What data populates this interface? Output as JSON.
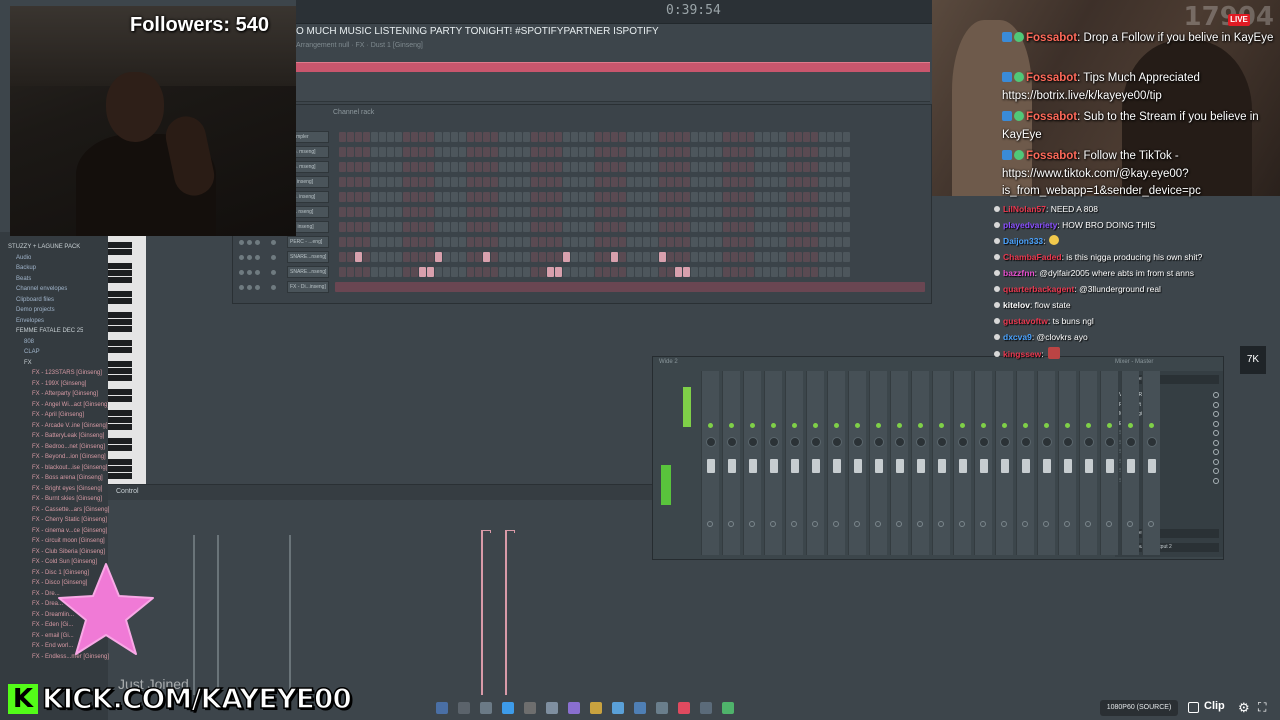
{
  "daw": {
    "time": "0:39:54",
    "marquee": "O MUCH MUSIC LISTENING PARTY TONIGHT! #SPOTIFYPARTNER ISPOTIFY",
    "pattern_label": "Arrangement null · FX · Dust 1 [Ginseng]",
    "channel_rack_title": "Channel rack",
    "channels": [
      {
        "name": "Sampler"
      },
      {
        "name": "Co. mseng]"
      },
      {
        "name": "Ch. mseng]"
      },
      {
        "name": "Fl. inseng]"
      },
      {
        "name": "Cu. inseng]"
      },
      {
        "name": "Lo. nseng]"
      },
      {
        "name": "Ci. inseng]"
      },
      {
        "name": "PERC - ...eng]"
      },
      {
        "name": "SNARE...nseng]"
      },
      {
        "name": "SNARE...nseng]"
      },
      {
        "name": "FX - Di...inseng]"
      }
    ],
    "browser": {
      "items": [
        {
          "label": "STUZZY + LAGUNE PACK",
          "indent": 0,
          "color": "#c8d0d4"
        },
        {
          "label": "Audio",
          "indent": 1,
          "color": "#9fb3c9"
        },
        {
          "label": "Backup",
          "indent": 1,
          "color": "#9fb3c9"
        },
        {
          "label": "Beats",
          "indent": 1,
          "color": "#9fb3c9"
        },
        {
          "label": "Channel envelopes",
          "indent": 1,
          "color": "#9fb3c9"
        },
        {
          "label": "Clipboard files",
          "indent": 1,
          "color": "#9fb3c9"
        },
        {
          "label": "Demo projects",
          "indent": 1,
          "color": "#9fb3c9"
        },
        {
          "label": "Envelopes",
          "indent": 1,
          "color": "#9fb3c9"
        },
        {
          "label": "FEMME FATALE DEC 25",
          "indent": 1,
          "color": "#c8d0d4"
        },
        {
          "label": "808",
          "indent": 2,
          "color": "#9fb3c9"
        },
        {
          "label": "CLAP",
          "indent": 2,
          "color": "#9fb3c9"
        },
        {
          "label": "FX",
          "indent": 2,
          "color": "#c8d0d4"
        },
        {
          "label": "FX - 123STARS [Ginseng]",
          "indent": 3,
          "color": "#d69aa4"
        },
        {
          "label": "FX - 199X [Ginseng]",
          "indent": 3,
          "color": "#d69aa4"
        },
        {
          "label": "FX - Afterparty [Ginseng]",
          "indent": 3,
          "color": "#d69aa4"
        },
        {
          "label": "FX - Angel Wi...act [Ginseng]",
          "indent": 3,
          "color": "#d69aa4"
        },
        {
          "label": "FX - April [Ginseng]",
          "indent": 3,
          "color": "#d69aa4"
        },
        {
          "label": "FX - Arcade V..ine [Ginseng]",
          "indent": 3,
          "color": "#d69aa4"
        },
        {
          "label": "FX - BatteryLeak [Ginseng]",
          "indent": 3,
          "color": "#d69aa4"
        },
        {
          "label": "FX - Bedroo...net [Ginseng]",
          "indent": 3,
          "color": "#d69aa4"
        },
        {
          "label": "FX - Beyond...ion [Ginseng]",
          "indent": 3,
          "color": "#d69aa4"
        },
        {
          "label": "FX - blackout...ise [Ginseng]",
          "indent": 3,
          "color": "#d69aa4"
        },
        {
          "label": "FX - Boss arena [Ginseng]",
          "indent": 3,
          "color": "#d69aa4"
        },
        {
          "label": "FX - Bright eyes [Ginseng]",
          "indent": 3,
          "color": "#d69aa4"
        },
        {
          "label": "FX - Burnt skies [Ginseng]",
          "indent": 3,
          "color": "#d69aa4"
        },
        {
          "label": "FX - Cassette...ars [Ginseng]",
          "indent": 3,
          "color": "#d69aa4"
        },
        {
          "label": "FX - Cherry Static [Ginseng]",
          "indent": 3,
          "color": "#d69aa4"
        },
        {
          "label": "FX - cinema v...ce [Ginseng]",
          "indent": 3,
          "color": "#d69aa4"
        },
        {
          "label": "FX - circuit moon [Ginseng]",
          "indent": 3,
          "color": "#d69aa4"
        },
        {
          "label": "FX - Club Siberia [Ginseng]",
          "indent": 3,
          "color": "#d69aa4"
        },
        {
          "label": "FX - Cold Sun [Ginseng]",
          "indent": 3,
          "color": "#d69aa4"
        },
        {
          "label": "FX - Disc 1 [Ginseng]",
          "indent": 3,
          "color": "#d69aa4"
        },
        {
          "label": "FX - Disco [Ginseng]",
          "indent": 3,
          "color": "#d69aa4"
        },
        {
          "label": "FX - Dre...",
          "indent": 3,
          "color": "#d69aa4"
        },
        {
          "label": "FX - Drea...",
          "indent": 3,
          "color": "#d69aa4"
        },
        {
          "label": "FX - Dreamlin...",
          "indent": 3,
          "color": "#d69aa4"
        },
        {
          "label": "FX - Eden [Gi...",
          "indent": 3,
          "color": "#d69aa4"
        },
        {
          "label": "FX - email [Gi...",
          "indent": 3,
          "color": "#d69aa4"
        },
        {
          "label": "FX - End worl...",
          "indent": 3,
          "color": "#d69aa4"
        },
        {
          "label": "FX - Endless...mer [Ginseng]",
          "indent": 3,
          "color": "#d69aa4"
        }
      ]
    },
    "control_label": "Control",
    "mixer": {
      "title": "Wide 2",
      "title_right": "Mixer - Master",
      "strip_count": 22,
      "slot_select_top": "(none)",
      "slots": [
        "VoxengoRecorder",
        "Fruity soft clipper",
        "MuseFlugin",
        "Edison",
        "Slot 5",
        "Slot 6",
        "Slot 7",
        "Slot 8",
        "Slot 9",
        "Slot 10"
      ],
      "slot_select_bottom": "(none)",
      "output": "Output 1 - Output 2"
    }
  },
  "stream": {
    "followers": "Followers: 540",
    "live_badge": "LIVE",
    "viewer_count_watermark": "17904",
    "joined_text": "Just Joined",
    "kick_letter": "K",
    "kick_url": "KICK.COM/KAYEYE00",
    "quality": "1080P60 (SOURCE)",
    "clip": "Clip",
    "side_button": "7K",
    "chat": [
      {
        "user": "Fossabot",
        "text": ": Drop a Follow if you belive in KayEye"
      },
      {
        "user": "Fossabot",
        "text": ": Tips Much Appreciated https://botrix.live/k/kayeye00/tip"
      },
      {
        "user": "Fossabot",
        "text": ": Sub to the Stream if you believe in KayEye"
      },
      {
        "user": "Fossabot",
        "text": ": Follow the TikTok - https://www.tiktok.com/@kay.eye00?is_from_webapp=1&sender_device=pc"
      }
    ],
    "chat_small": [
      {
        "user": "LilNolan57",
        "user_color": "#e8384f",
        "text": ": NEED A 808"
      },
      {
        "user": "playedvariety",
        "user_color": "#8a4fff",
        "text": ": HOW BRO DOING THIS"
      },
      {
        "user": "Daijon333",
        "user_color": "#4aa3ff",
        "text": ":"
      },
      {
        "user": "ChambaFaded",
        "user_color": "#e8384f",
        "text": ": is this nigga producing his own shit?"
      },
      {
        "user": "bazzfnn",
        "user_color": "#e84fd0",
        "text": ": @dylfair2005 where abts im from st anns"
      },
      {
        "user": "quarterbackagent",
        "user_color": "#e8384f",
        "text": ": @3llunderground real"
      },
      {
        "user": "kitelov",
        "user_color": "#ffffff",
        "text": ": flow state"
      },
      {
        "user": "gustavoftw",
        "user_color": "#e8384f",
        "text": ": ts buns ngl"
      },
      {
        "user": "dxcva9",
        "user_color": "#4aa3ff",
        "text": ": @clovkrs ayo"
      },
      {
        "user": "kingssew",
        "user_color": "#e8384f",
        "text": ":"
      }
    ]
  }
}
